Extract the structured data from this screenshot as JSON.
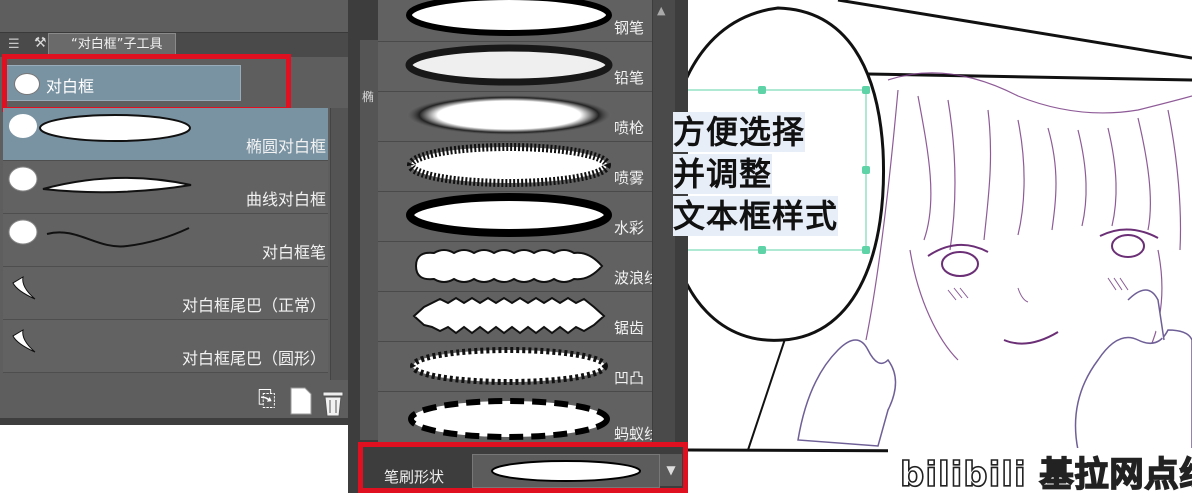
{
  "left_panel": {
    "tab_title": "“对白框”子工具",
    "group_label": "对白框",
    "items": [
      {
        "label": "椭圆对白框",
        "selected": true
      },
      {
        "label": "曲线对白框",
        "selected": false
      },
      {
        "label": "对白框笔",
        "selected": false
      },
      {
        "label": "对白框尾巴（正常）",
        "selected": false
      },
      {
        "label": "对白框尾巴（圆形）",
        "selected": false
      }
    ],
    "footer_icons": [
      "copy-icon",
      "new-page-icon",
      "trash-icon"
    ]
  },
  "middle_panel": {
    "side_label": "椭",
    "brush_shapes": [
      {
        "label": "钢笔",
        "style": "pen"
      },
      {
        "label": "铅笔",
        "style": "pencil"
      },
      {
        "label": "喷枪",
        "style": "airbrush"
      },
      {
        "label": "喷雾",
        "style": "spray"
      },
      {
        "label": "水彩",
        "style": "watercolor"
      },
      {
        "label": "波浪线",
        "style": "wave"
      },
      {
        "label": "锯齿",
        "style": "zigzag"
      },
      {
        "label": "凹凸",
        "style": "bumpy"
      },
      {
        "label": "蚂蚁线",
        "style": "dashed"
      }
    ],
    "brush_shape_label": "笔刷形状"
  },
  "canvas": {
    "caption_lines": [
      "方便选择",
      "并调整",
      "文本框样式"
    ],
    "watermark": "bilibili 基拉网点纸"
  },
  "colors": {
    "highlight": "#e01020",
    "selected_bg": "#7a93a3",
    "panel_bg": "#5e5e5e",
    "handle": "#5fd3a8",
    "line_art": "#7b3f86"
  }
}
